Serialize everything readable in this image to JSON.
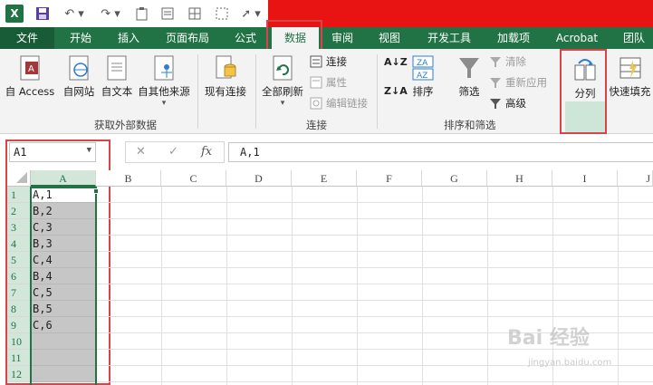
{
  "qat": {
    "logo": "X",
    "save_icon": "save-icon",
    "undo_icon": "undo-icon",
    "redo_icon": "redo-icon"
  },
  "tabs": [
    {
      "label": "文件"
    },
    {
      "label": "开始"
    },
    {
      "label": "插入"
    },
    {
      "label": "页面布局"
    },
    {
      "label": "公式"
    },
    {
      "label": "数据"
    },
    {
      "label": "审阅"
    },
    {
      "label": "视图"
    },
    {
      "label": "开发工具"
    },
    {
      "label": "加载项"
    },
    {
      "label": "Acrobat"
    },
    {
      "label": "团队"
    }
  ],
  "ribbon": {
    "get_external": {
      "buttons": [
        "自 Access",
        "自网站",
        "自文本",
        "自其他来源",
        "现有连接"
      ],
      "label": "获取外部数据"
    },
    "connections": {
      "refresh_all": "全部刷新",
      "connections": "连接",
      "properties": "属性",
      "edit_links": "编辑链接",
      "label": "连接"
    },
    "sort_filter": {
      "sort": "排序",
      "filter": "筛选",
      "clear": "清除",
      "reapply": "重新应用",
      "advanced": "高级",
      "label": "排序和筛选"
    },
    "tools": {
      "split": "分列",
      "flash_fill": "快速填充"
    }
  },
  "formula_bar": {
    "name_box": "A1",
    "fx": "fx",
    "value": "A,1"
  },
  "grid": {
    "columns": [
      "A",
      "B",
      "C",
      "D",
      "E",
      "F",
      "G",
      "H",
      "I",
      "J"
    ],
    "rows": [
      "1",
      "2",
      "3",
      "4",
      "5",
      "6",
      "7",
      "8",
      "9",
      "10",
      "11",
      "12"
    ],
    "column_a": [
      "A,1",
      "B,2",
      "C,3",
      "B,3",
      "C,4",
      "B,4",
      "C,5",
      "B,5",
      "C,6",
      "",
      "",
      ""
    ]
  },
  "watermark": {
    "main": "Bai 经验",
    "sub": "jingyan.baidu.com"
  },
  "colors": {
    "excel_green": "#217346",
    "highlight_red": "#d9444a",
    "title_red": "#e81414"
  }
}
